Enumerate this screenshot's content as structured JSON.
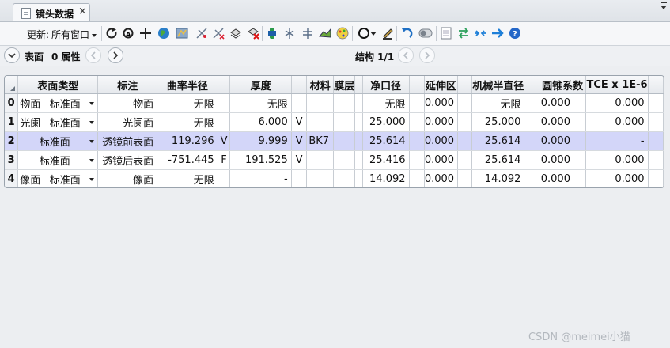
{
  "tab": {
    "title": "镜头数据",
    "close": "×"
  },
  "toolbar": {
    "update_label": "更新:",
    "update_value": "所有窗口",
    "icons": [
      "refresh-icon",
      "auto-update-icon",
      "move-icon",
      "globe-icon",
      "layout-icon",
      "pickup-icon",
      "remove-pickup-icon",
      "make-double-icon",
      "remove-double-icon",
      "tilt-icon",
      "reverse-icon",
      "scale-icon",
      "fold-icon",
      "ray-aiming-icon",
      "circle-icon",
      "edit-icon",
      "undo-icon",
      "toggle-icon",
      "sheet-icon",
      "arrows-icon",
      "converge-icon",
      "next-icon",
      "help-icon"
    ]
  },
  "navbar": {
    "surface_label": "表面",
    "property_label": "0 属性",
    "config_label": "结构 1/1"
  },
  "table": {
    "headers": [
      "",
      "表面类型",
      "标注",
      "曲率半径",
      "",
      "厚度",
      "",
      "材料",
      "膜层",
      "",
      "净口径",
      "",
      "延伸区",
      "",
      "机械半直径",
      "",
      "圆锥系数",
      "TCE x 1E-6",
      ""
    ],
    "rows": [
      {
        "index": "0",
        "name": "物面",
        "type": "标准面",
        "comment": "物面",
        "radius": "无限",
        "radius_solve": "",
        "thickness": "无限",
        "thickness_solve": "",
        "material": "",
        "coating": "",
        "clear": "无限",
        "chip": "0.000",
        "mech": "无限",
        "conic": "0.000",
        "tce": "0.000"
      },
      {
        "index": "1",
        "name": "光阑",
        "type": "标准面",
        "comment": "光阑面",
        "radius": "无限",
        "radius_solve": "",
        "thickness": "6.000",
        "thickness_solve": "V",
        "material": "",
        "coating": "",
        "clear": "25.000",
        "chip": "0.000",
        "mech": "25.000",
        "conic": "0.000",
        "tce": "0.000"
      },
      {
        "index": "2",
        "name": "",
        "type": "标准面",
        "comment": "透镜前表面",
        "radius": "119.296",
        "radius_solve": "V",
        "thickness": "9.999",
        "thickness_solve": "V",
        "material": "BK7",
        "coating": "",
        "clear": "25.614",
        "chip": "0.000",
        "mech": "25.614",
        "conic": "0.000",
        "tce": "-"
      },
      {
        "index": "3",
        "name": "",
        "type": "标准面",
        "comment": "透镜后表面",
        "radius": "-751.445",
        "radius_solve": "F",
        "thickness": "191.525",
        "thickness_solve": "V",
        "material": "",
        "coating": "",
        "clear": "25.416",
        "chip": "0.000",
        "mech": "25.614",
        "conic": "0.000",
        "tce": "0.000"
      },
      {
        "index": "4",
        "name": "像面",
        "type": "标准面",
        "comment": "像面",
        "radius": "无限",
        "radius_solve": "",
        "thickness": "-",
        "thickness_solve": "",
        "material": "",
        "coating": "",
        "clear": "14.092",
        "chip": "0.000",
        "mech": "14.092",
        "conic": "0.000",
        "tce": "0.000"
      }
    ]
  },
  "watermark": "CSDN @meimei小猫",
  "colors": {
    "selected_row": "#d3d6f9",
    "background": "#eceef1"
  }
}
